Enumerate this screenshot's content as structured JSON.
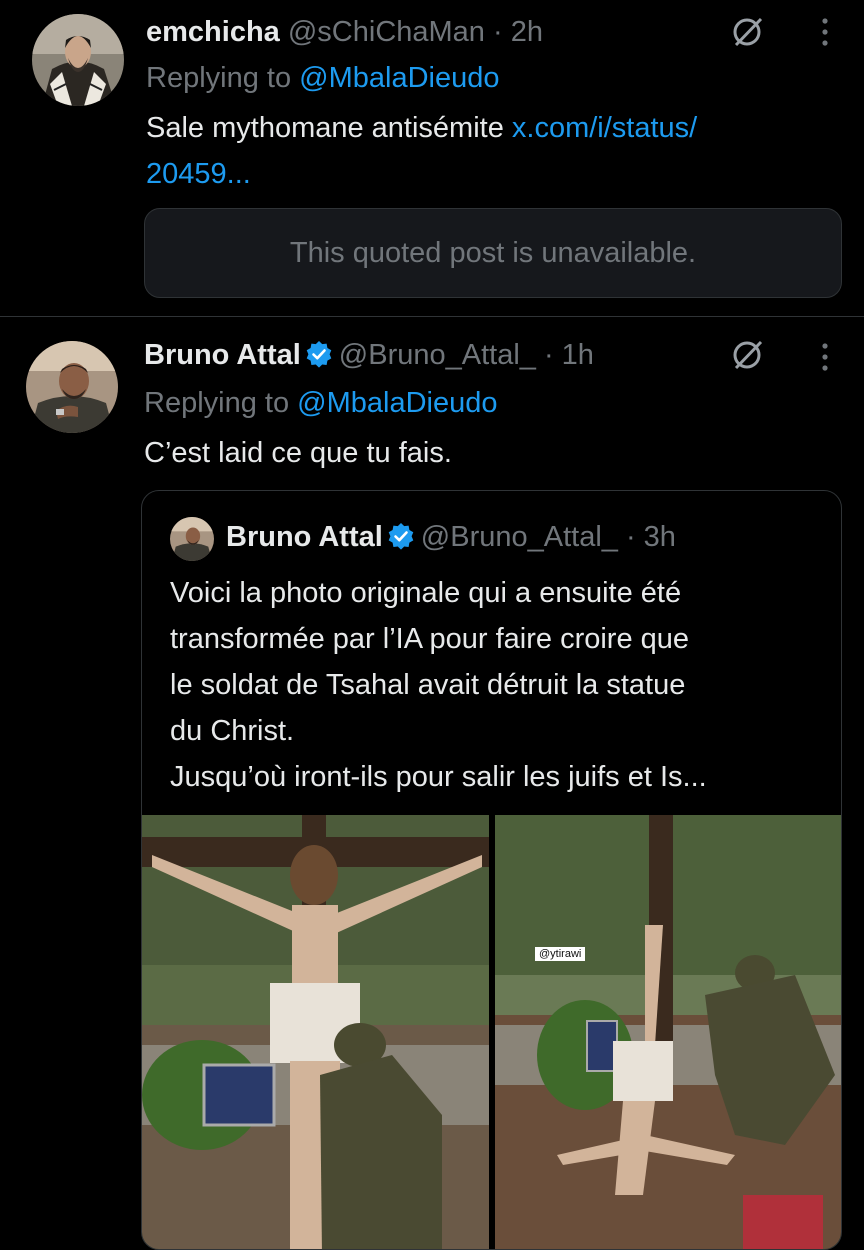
{
  "post1": {
    "display_name": "emchicha",
    "handle": "@sChiChaMan",
    "time": "· 2h",
    "replying_prefix": "Replying to ",
    "replying_to": "@MbalaDieudo",
    "text": "Sale mythomane antisémite ",
    "link_part1": "x.com/i/status/",
    "link_part2": "20459...",
    "quoted_unavailable": "This quoted post is unavailable."
  },
  "post2": {
    "display_name": "Bruno Attal",
    "handle": "@Bruno_Attal_",
    "time": "· 1h",
    "replying_prefix": "Replying to ",
    "replying_to": "@MbalaDieudo",
    "text": "C’est laid ce que tu fais.",
    "quote": {
      "display_name": "Bruno Attal",
      "handle": "@Bruno_Attal_",
      "time": "· 3h",
      "lines": [
        "Voici la photo originale qui a ensuite été",
        "transformée par l’IA pour faire croire que",
        "le soldat de Tsahal avait détruit la statue",
        "du Christ.",
        "Jusqu’où iront-ils pour salir les juifs et Is..."
      ],
      "image_watermark": "@ytirawi"
    }
  },
  "colors": {
    "background": "#000000",
    "text": "#e7e9ea",
    "muted": "#71767b",
    "link": "#1d9bf0",
    "verified": "#1d9bf0",
    "border": "#2f3336"
  },
  "icons": [
    "grok-icon",
    "more-options-icon",
    "verified-badge-icon"
  ]
}
